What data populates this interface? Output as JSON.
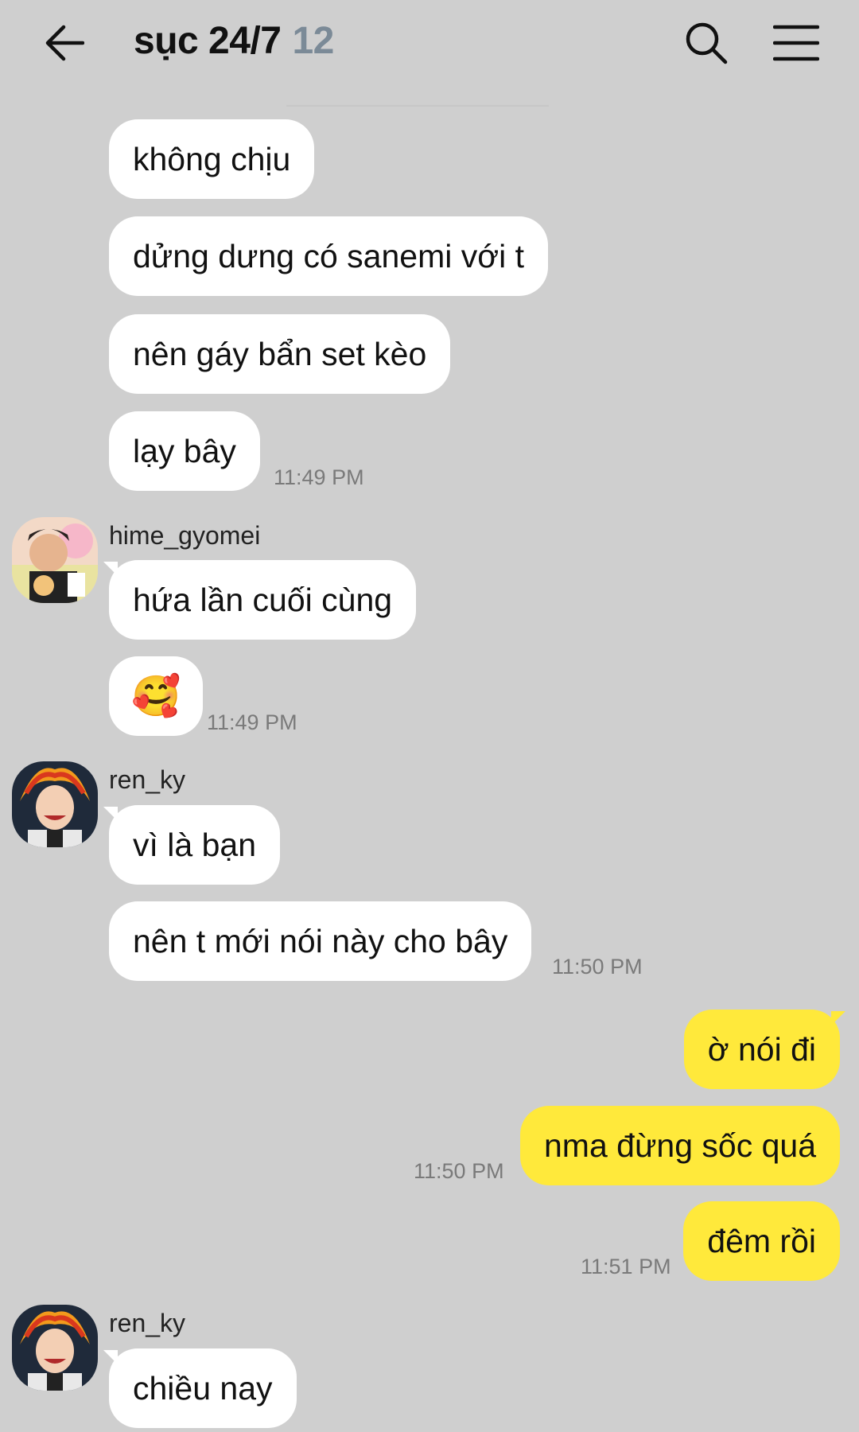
{
  "header": {
    "title": "sục 24/7",
    "member_count": "12"
  },
  "messages": {
    "m1": "không chịu",
    "m2": "dửng dưng có sanemi với t",
    "m3": "nên gáy bẩn set kèo",
    "m4": "lạy bây",
    "t1": "11:49 PM",
    "s1": "hime_gyomei",
    "m5": "hứa lần cuối cùng",
    "m6": "🥰",
    "t2": "11:49 PM",
    "s2": "ren_ky",
    "m7": "vì là bạn",
    "m8": "nên t mới nói này cho bây",
    "t3": "11:50 PM",
    "m9": "ờ nói đi",
    "m10": "nma đừng sốc quá",
    "t4": "11:50 PM",
    "m11": "đêm rồi",
    "t5": "11:51 PM",
    "s3": "ren_ky",
    "m12": "chiều nay"
  },
  "icons": {
    "back": "arrow-left-icon",
    "search": "search-icon",
    "menu": "hamburger-menu-icon"
  },
  "colors": {
    "background": "#cfcfcf",
    "incoming_bubble": "#ffffff",
    "outgoing_bubble": "#ffe93b",
    "member_count": "#7b8a97",
    "timestamp": "#7a7a7a"
  }
}
